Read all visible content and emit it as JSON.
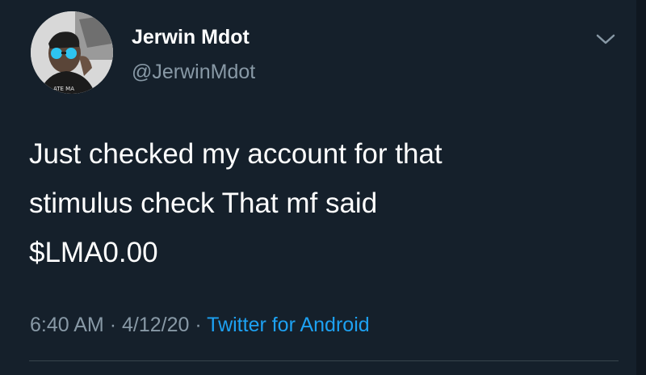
{
  "tweet": {
    "author": {
      "display_name": "Jerwin Mdot",
      "handle": "@JerwinMdot",
      "avatar_icon": "profile-photo"
    },
    "text": "Just checked my account for that\nstimulus check That mf said\n$LMA0.00",
    "time": "6:40 AM",
    "separator": "·",
    "date": "4/12/20",
    "source": "Twitter for Android",
    "menu_icon": "chevron-down-icon"
  },
  "colors": {
    "background": "#15202b",
    "primary_text": "#ffffff",
    "secondary_text": "#8899a6",
    "link": "#1da1f2"
  }
}
